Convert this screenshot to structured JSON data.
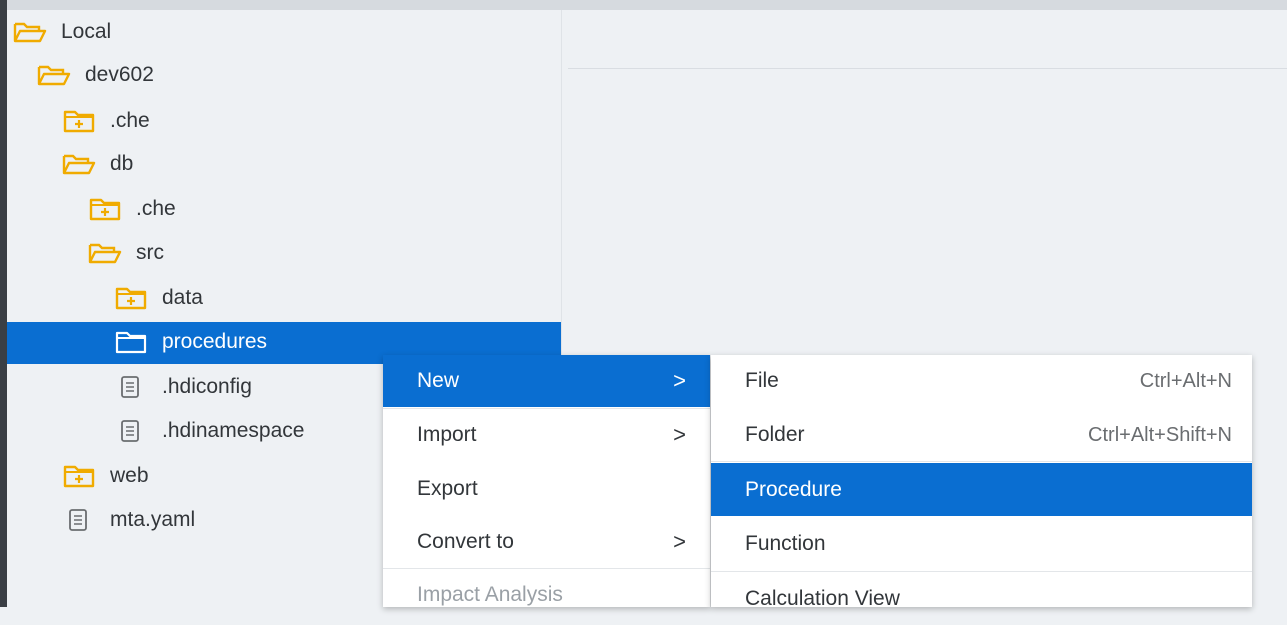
{
  "tree": {
    "items": [
      {
        "label": "Local",
        "icon": "folder-open-icon"
      },
      {
        "label": "dev602",
        "icon": "folder-open-icon"
      },
      {
        "label": ".che",
        "icon": "folder-closed-icon"
      },
      {
        "label": "db",
        "icon": "folder-open-icon"
      },
      {
        "label": ".che",
        "icon": "folder-closed-icon"
      },
      {
        "label": "src",
        "icon": "folder-open-icon"
      },
      {
        "label": "data",
        "icon": "folder-closed-icon"
      },
      {
        "label": "procedures",
        "icon": "folder-empty-icon"
      },
      {
        "label": ".hdiconfig",
        "icon": "file-icon"
      },
      {
        "label": ".hdinamespace",
        "icon": "file-icon"
      },
      {
        "label": "web",
        "icon": "folder-closed-icon"
      },
      {
        "label": "mta.yaml",
        "icon": "file-icon"
      }
    ],
    "selected": "procedures"
  },
  "context_menu": {
    "items": [
      {
        "label": "New",
        "submenu": true,
        "highlighted": true
      },
      {
        "label": "Import",
        "submenu": true
      },
      {
        "label": "Export",
        "submenu": false
      },
      {
        "label": "Convert to",
        "submenu": true
      },
      {
        "label": "Impact Analysis",
        "disabled": true
      }
    ],
    "arrow_glyph": ">"
  },
  "new_submenu": {
    "items": [
      {
        "label": "File",
        "shortcut": "Ctrl+Alt+N"
      },
      {
        "label": "Folder",
        "shortcut": "Ctrl+Alt+Shift+N"
      },
      {
        "label": "Procedure",
        "shortcut": "",
        "highlighted": true
      },
      {
        "label": "Function",
        "shortcut": ""
      },
      {
        "label": "Calculation View",
        "shortcut": ""
      }
    ]
  },
  "colors": {
    "accent": "#0a6ed1",
    "folder": "#f0ab00"
  }
}
